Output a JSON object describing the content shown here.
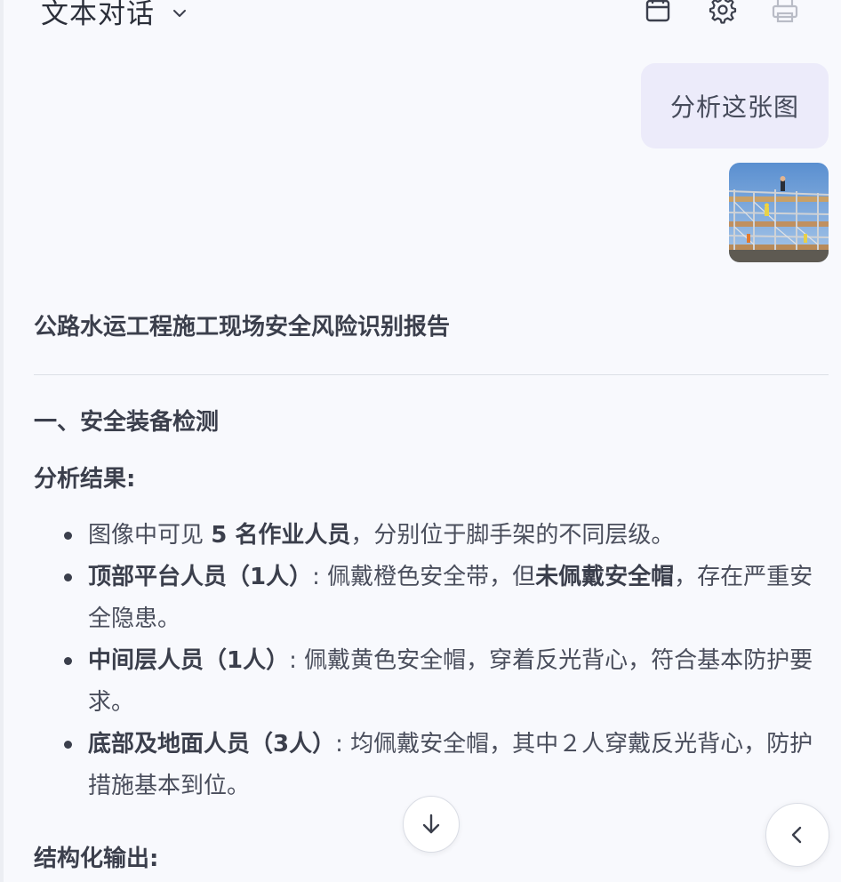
{
  "header": {
    "title": "文本对话",
    "icons": [
      "chevron-down-icon",
      "calendar-icon",
      "gear-icon",
      "printer-icon"
    ]
  },
  "user_message": {
    "text": "分析这张图",
    "image": "scaffolding-photo"
  },
  "response": {
    "report_title": "公路水运工程施工现场安全风险识别报告",
    "section1_heading": "一、安全装备检测",
    "analysis_label": "分析结果:",
    "bullets": [
      {
        "pre": "图像中可见 ",
        "bold": "5 名作业人员",
        "post": "，分别位于脚手架的不同层级。"
      },
      {
        "bold": "顶部平台人员（1人）",
        "mid": ": 佩戴橙色安全带，但",
        "bold2": "未佩戴安全帽",
        "post": "，存在严重安全隐患。"
      },
      {
        "bold": "中间层人员（1人）",
        "post": ": 佩戴黄色安全帽，穿着反光背心，符合基本防护要求。"
      },
      {
        "bold": "底部及地面人员（3人）",
        "post": ": 均佩戴安全帽，其中２人穿戴反光背心，防护措施基本到位。"
      }
    ],
    "structured_label": "结构化输出:"
  },
  "buttons": {
    "scroll_down": "arrow-down-icon",
    "back": "chevron-left-icon"
  }
}
